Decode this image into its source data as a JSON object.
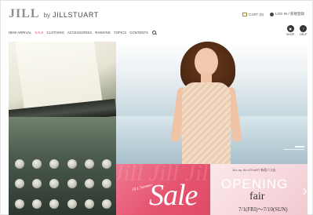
{
  "header": {
    "logo_mark": "JILL",
    "logo_by": "by",
    "logo_brand": "JILLSTUART",
    "util": {
      "cart_label": "CART (0)",
      "login_label": "LOG IN / 新規登録"
    },
    "nav": [
      {
        "label": "NEW ARRIVAL"
      },
      {
        "label": "SALE"
      },
      {
        "label": "CLOTHING"
      },
      {
        "label": "ACCESSORIES"
      },
      {
        "label": "RANKING"
      },
      {
        "label": "TOPICS"
      },
      {
        "label": "CONTENTS"
      }
    ],
    "shop_label": "SHOP",
    "help_label": "HELP",
    "shop_icon_glyph": "▣",
    "help_icon_glyph": "?"
  },
  "hero": {
    "sale_banner": {
      "bg_text": "Jill Jill Jill",
      "sub": "JILL Summer",
      "main": "Sale"
    },
    "opening_banner": {
      "small": "JILL by JILLSTUART 新宿バス店",
      "title": "OPENING",
      "fair": "fair",
      "date": "7/1(FRI)〜7/10(SUN)"
    }
  },
  "colors": {
    "accent_sale": "#e5546f",
    "opening_bg": "#f7dadf",
    "logo_gray": "#8f8f8f"
  }
}
